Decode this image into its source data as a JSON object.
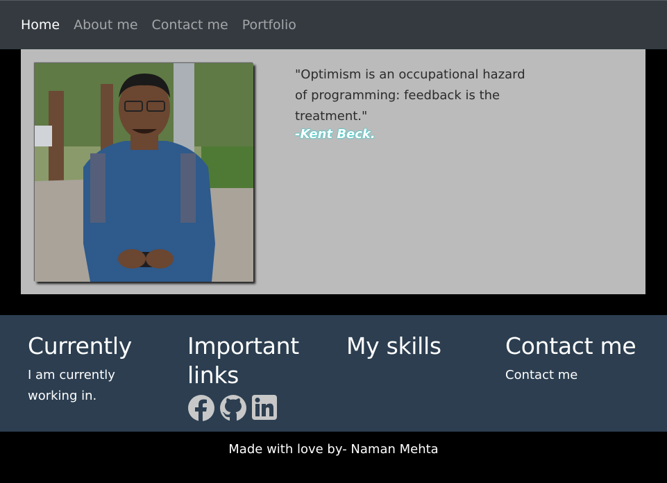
{
  "nav": {
    "items": [
      {
        "label": "Home",
        "active": true
      },
      {
        "label": "About me",
        "active": false
      },
      {
        "label": "Contact me",
        "active": false
      },
      {
        "label": "Portfolio",
        "active": false
      }
    ]
  },
  "hero": {
    "quote": "\"Optimism is an occupational hazard of programming: feedback is the treatment.\"",
    "author": "-Kent Beck."
  },
  "footer": {
    "currently": {
      "heading": "Currently",
      "text": "I am currently working in."
    },
    "links": {
      "heading": "Important links",
      "icons": [
        "facebook-icon",
        "github-icon",
        "linkedin-icon"
      ]
    },
    "skills": {
      "heading": "My skills"
    },
    "contact": {
      "heading": "Contact me",
      "text": "Contact me"
    }
  },
  "credit": "Made with love by- Naman Mehta",
  "colors": {
    "navbar": "#343a40",
    "hero_bg": "#bbbbbb",
    "footer_bg": "#2c3e50",
    "page_bg": "#000000",
    "author_glow": "#00d0d0"
  }
}
